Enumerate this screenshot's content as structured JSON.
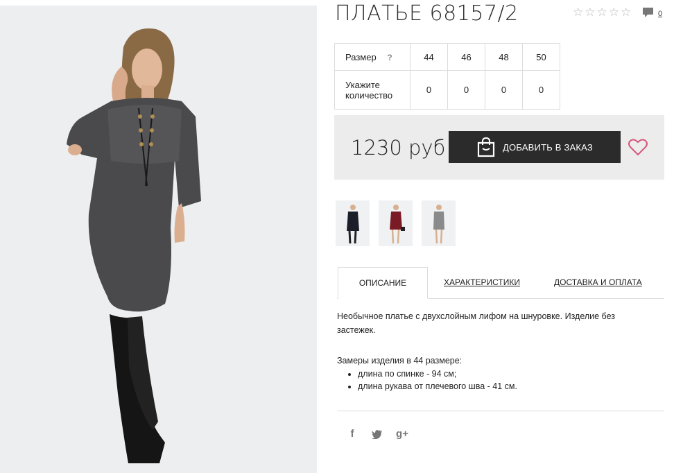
{
  "product": {
    "title": "ПЛАТЬЕ 68157/2",
    "rating_stars": 5,
    "rating_value": 0,
    "comments_count": "0"
  },
  "sizes": {
    "size_label": "Размер",
    "help_mark": "?",
    "sizes": [
      "44",
      "46",
      "48",
      "50"
    ],
    "qty_label_line1": "Укажите",
    "qty_label_line2": "количество",
    "quantities": [
      "0",
      "0",
      "0",
      "0"
    ]
  },
  "buy": {
    "price": "1230 руб",
    "order_button": "ДОБАВИТЬ В ЗАКАЗ"
  },
  "thumbnails": [
    {
      "name": "thumb-black",
      "color": "#1c1f2a"
    },
    {
      "name": "thumb-burgundy",
      "color": "#7a1a24"
    },
    {
      "name": "thumb-gray",
      "color": "#8a8a8a"
    }
  ],
  "tabs": {
    "description": "ОПИСАНИЕ",
    "characteristics": "ХАРАКТЕРИСТИКИ",
    "delivery": "ДОСТАВКА И ОПЛАТА"
  },
  "description": {
    "text": "Необычное платье с двухслойным лифом на шнуровке. Изделие без застежек.",
    "measure_title": "Замеры изделия в 44 размере:",
    "measures": [
      "длина по спинке - 94 см;",
      "длина рукава от плечевого шва - 41 см."
    ]
  },
  "social": {
    "facebook": "f",
    "twitter": "twitter-icon",
    "googleplus": "g+"
  },
  "colors": {
    "button_bg": "#2b2b2b",
    "buybox_bg": "#ececec",
    "heart": "#d6547a",
    "photo_bg": "#eceef0"
  }
}
